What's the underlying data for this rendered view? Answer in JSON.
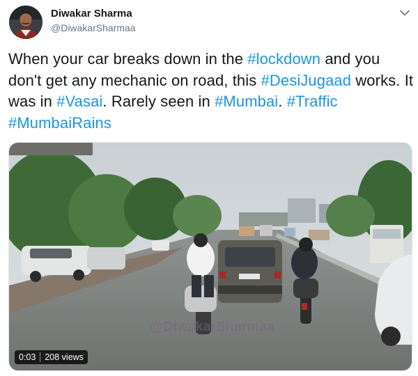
{
  "tweet": {
    "author": {
      "name": "Diwakar Sharma",
      "handle": "@DiwakarSharmaa"
    },
    "text_segments": [
      {
        "text": "When your car breaks down in the ",
        "hashtag": false
      },
      {
        "text": "#lockdown",
        "hashtag": true
      },
      {
        "text": " and you don't get any mechanic on road, this ",
        "hashtag": false
      },
      {
        "text": "#DesiJugaad",
        "hashtag": true
      },
      {
        "text": " works. It was in ",
        "hashtag": false
      },
      {
        "text": "#Vasai",
        "hashtag": true
      },
      {
        "text": ". Rarely seen in ",
        "hashtag": false
      },
      {
        "text": "#Mumbai",
        "hashtag": true
      },
      {
        "text": ". ",
        "hashtag": false
      },
      {
        "text": "#Traffic",
        "hashtag": true
      },
      {
        "text": " ",
        "hashtag": false
      },
      {
        "text": "#MumbaiRains",
        "hashtag": true
      }
    ],
    "video": {
      "duration": "0:03",
      "views": "208 views",
      "watermark": "@DiwakarSharmaa"
    }
  },
  "icons": {
    "more_menu": "chevron-down-icon",
    "avatar": "avatar-photo"
  },
  "colors": {
    "hashtag": "#1b95e0",
    "text": "#14171a",
    "secondary": "#657786"
  }
}
